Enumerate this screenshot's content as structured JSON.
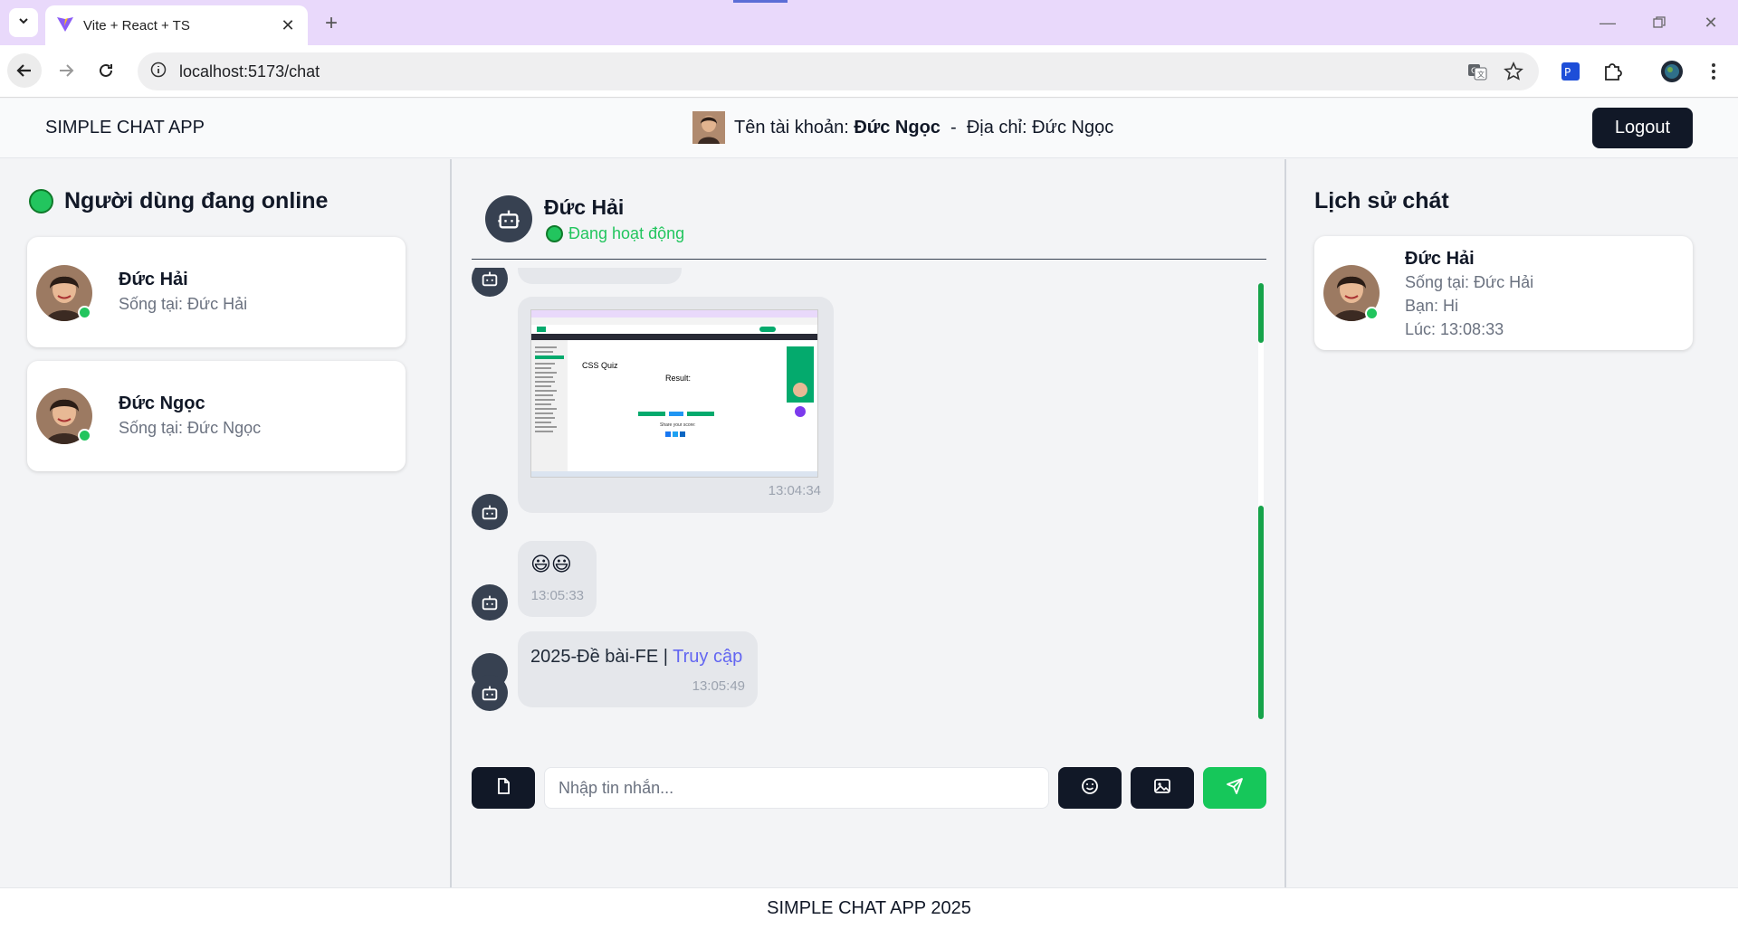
{
  "browser": {
    "tab_title": "Vite + React + TS",
    "url": "localhost:5173/chat"
  },
  "header": {
    "brand": "SIMPLE CHAT APP",
    "account_label": "Tên tài khoản:",
    "account_name": "Đức Ngọc",
    "separator": "-",
    "address_label": "Địa chỉ:",
    "address_value": "Đức Ngọc",
    "logout_label": "Logout"
  },
  "online": {
    "title": "Người dùng đang online",
    "users": [
      {
        "name": "Đức Hải",
        "location": "Sống tại: Đức Hải"
      },
      {
        "name": "Đức Ngọc",
        "location": "Sống tại: Đức Ngọc"
      }
    ]
  },
  "chat": {
    "partner_name": "Đức Hải",
    "partner_status": "Đang hoạt động",
    "messages": [
      {
        "type": "image",
        "time": "13:04:34"
      },
      {
        "type": "emoji",
        "text": "😃😃",
        "time": "13:05:33"
      },
      {
        "type": "file",
        "text": "2025-Đề bài-FE |",
        "link": "Truy cập",
        "time": "13:05:49"
      }
    ],
    "screenshot_preview": {
      "quiz_title": "CSS Quiz",
      "result_label": "Result:",
      "share_label": "Share your score:"
    },
    "input_placeholder": "Nhập tin nhắn..."
  },
  "history": {
    "title": "Lịch sử chát",
    "items": [
      {
        "name": "Đức Hải",
        "location": "Sống tại: Đức Hải",
        "last_message": "Bạn: Hi",
        "time": "Lúc: 13:08:33"
      }
    ]
  },
  "footer": {
    "text": "SIMPLE CHAT APP 2025"
  },
  "colors": {
    "online_green": "#22c55e",
    "dark": "#111827",
    "send_green": "#16c75a",
    "link_blue": "#6366f1"
  },
  "icons": [
    "chevron-down-icon",
    "vite-logo-icon",
    "close-icon",
    "plus-icon",
    "back-icon",
    "forward-icon",
    "reload-icon",
    "site-info-icon",
    "translate-icon",
    "star-icon",
    "extension-icon",
    "puzzle-icon",
    "profile-icon",
    "menu-icon",
    "robot-icon",
    "file-icon",
    "emoji-icon",
    "image-icon",
    "send-icon"
  ]
}
